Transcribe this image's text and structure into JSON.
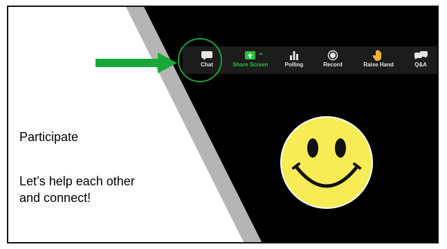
{
  "toolbar": {
    "items": [
      {
        "label": "Chat",
        "icon": "chat-bubble-icon"
      },
      {
        "label": "Share Screen",
        "icon": "share-screen-icon"
      },
      {
        "label": "Polling",
        "icon": "polling-icon"
      },
      {
        "label": "Record",
        "icon": "record-icon"
      },
      {
        "label": "Raise Hand",
        "icon": "raise-hand-icon"
      },
      {
        "label": "Q&A",
        "icon": "qa-icon"
      }
    ]
  },
  "content": {
    "heading": "Participate",
    "body_line1": "Let’s help each other",
    "body_line2": "and connect!"
  },
  "colors": {
    "arrow": "#17a838",
    "share_accent": "#25c33a",
    "smiley_fill": "#f7ec55",
    "background_dark": "#000000"
  }
}
